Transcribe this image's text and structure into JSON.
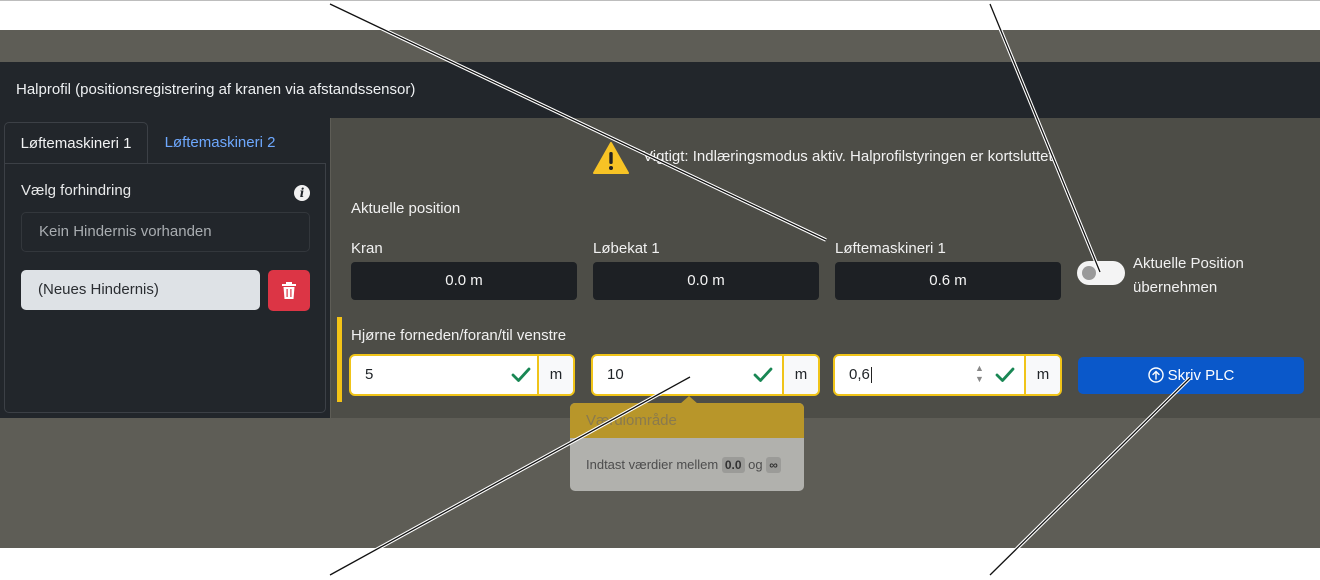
{
  "header": {
    "title": "Halprofil (positionsregistrering af kranen via afstandssensor)"
  },
  "tabs": [
    {
      "label": "Løftemaskineri 1",
      "active": true
    },
    {
      "label": "Løftemaskineri 2",
      "active": false
    }
  ],
  "obstacle": {
    "label": "Vælg forhindring",
    "info_icon": "i",
    "empty_option": "Kein Hindernis vorhanden",
    "new_option": "(Neues Hindernis)",
    "delete_icon": "trash-icon"
  },
  "warning": {
    "icon": "warning-triangle-icon",
    "text": "Vigtigt: Indlæringsmodus aktiv. Halprofilstyringen er kortsluttet."
  },
  "current_position": {
    "title": "Aktuelle position",
    "fields": [
      {
        "label": "Kran",
        "value": "0.0 m"
      },
      {
        "label": "Løbekat 1",
        "value": "0.0 m"
      },
      {
        "label": "Løftemaskineri 1",
        "value": "0.6 m"
      }
    ],
    "toggle_label": "Aktuelle Position übernehmen",
    "toggle_on": false
  },
  "corner": {
    "title": "Hjørne forneden/foran/til venstre",
    "inputs": [
      {
        "value": "5",
        "unit": "m"
      },
      {
        "value": "10",
        "unit": "m"
      },
      {
        "value": "0,6",
        "unit": "m"
      }
    ],
    "write_button": "Skriv PLC"
  },
  "tooltip": {
    "title": "Værdiområde",
    "text": "Indtast værdier mellem",
    "min": "0.0",
    "and": "og",
    "max": "∞"
  },
  "colors": {
    "accent_yellow": "#f0c419",
    "primary_blue": "#0a58ca",
    "danger_red": "#dc3545",
    "valid_green": "#198754"
  }
}
